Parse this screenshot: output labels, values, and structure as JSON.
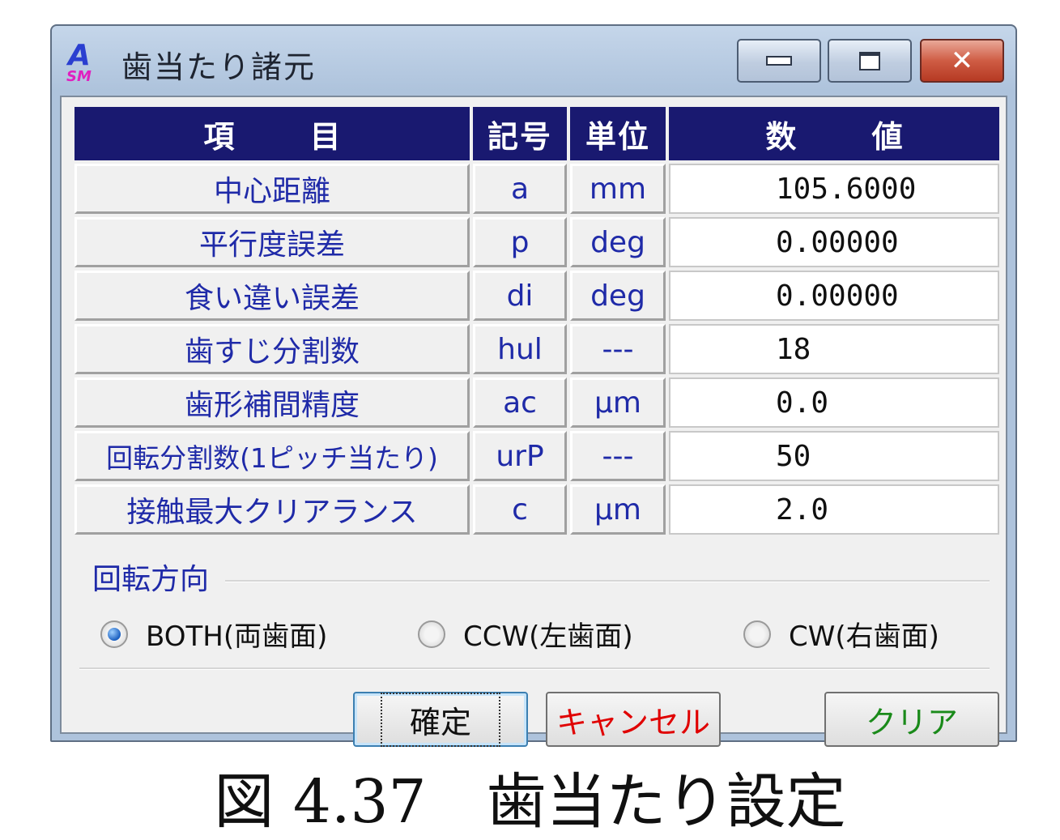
{
  "window": {
    "title": "歯当たり諸元",
    "icon_label": "A SM",
    "controls": {
      "minimize_icon": "minimize-icon",
      "maximize_icon": "maximize-icon",
      "close_icon": "close-icon",
      "close_glyph": "✕"
    }
  },
  "table": {
    "headers": [
      "項 目",
      "記号",
      "単位",
      "数 値"
    ],
    "rows": [
      {
        "item": "中心距離",
        "symbol": "a",
        "unit": "mm",
        "value": "105.6000"
      },
      {
        "item": "平行度誤差",
        "symbol": "p",
        "unit": "deg",
        "value": "0.00000"
      },
      {
        "item": "食い違い誤差",
        "symbol": "di",
        "unit": "deg",
        "value": "0.00000"
      },
      {
        "item": "歯すじ分割数",
        "symbol": "hul",
        "unit": "---",
        "value": "18"
      },
      {
        "item": "歯形補間精度",
        "symbol": "ac",
        "unit": "μm",
        "value": "0.0"
      },
      {
        "item": "回転分割数(1ピッチ当たり)",
        "symbol": "urP",
        "unit": "---",
        "value": "50"
      },
      {
        "item": "接触最大クリアランス",
        "symbol": "c",
        "unit": "μm",
        "value": "2.0"
      }
    ]
  },
  "rotation": {
    "title": "回転方向",
    "options": [
      "BOTH(両歯面)",
      "CCW(左歯面)",
      "CW(右歯面)"
    ],
    "selected": "BOTH(両歯面)"
  },
  "buttons": {
    "ok": "確定",
    "cancel": "キャンセル",
    "clear": "クリア"
  },
  "colors": {
    "header_bg": "#191970",
    "label_text": "#1f2aa8",
    "cancel_text": "#e00000",
    "clear_text": "#1a8a1a"
  },
  "caption": "図 4.37　歯当たり設定"
}
